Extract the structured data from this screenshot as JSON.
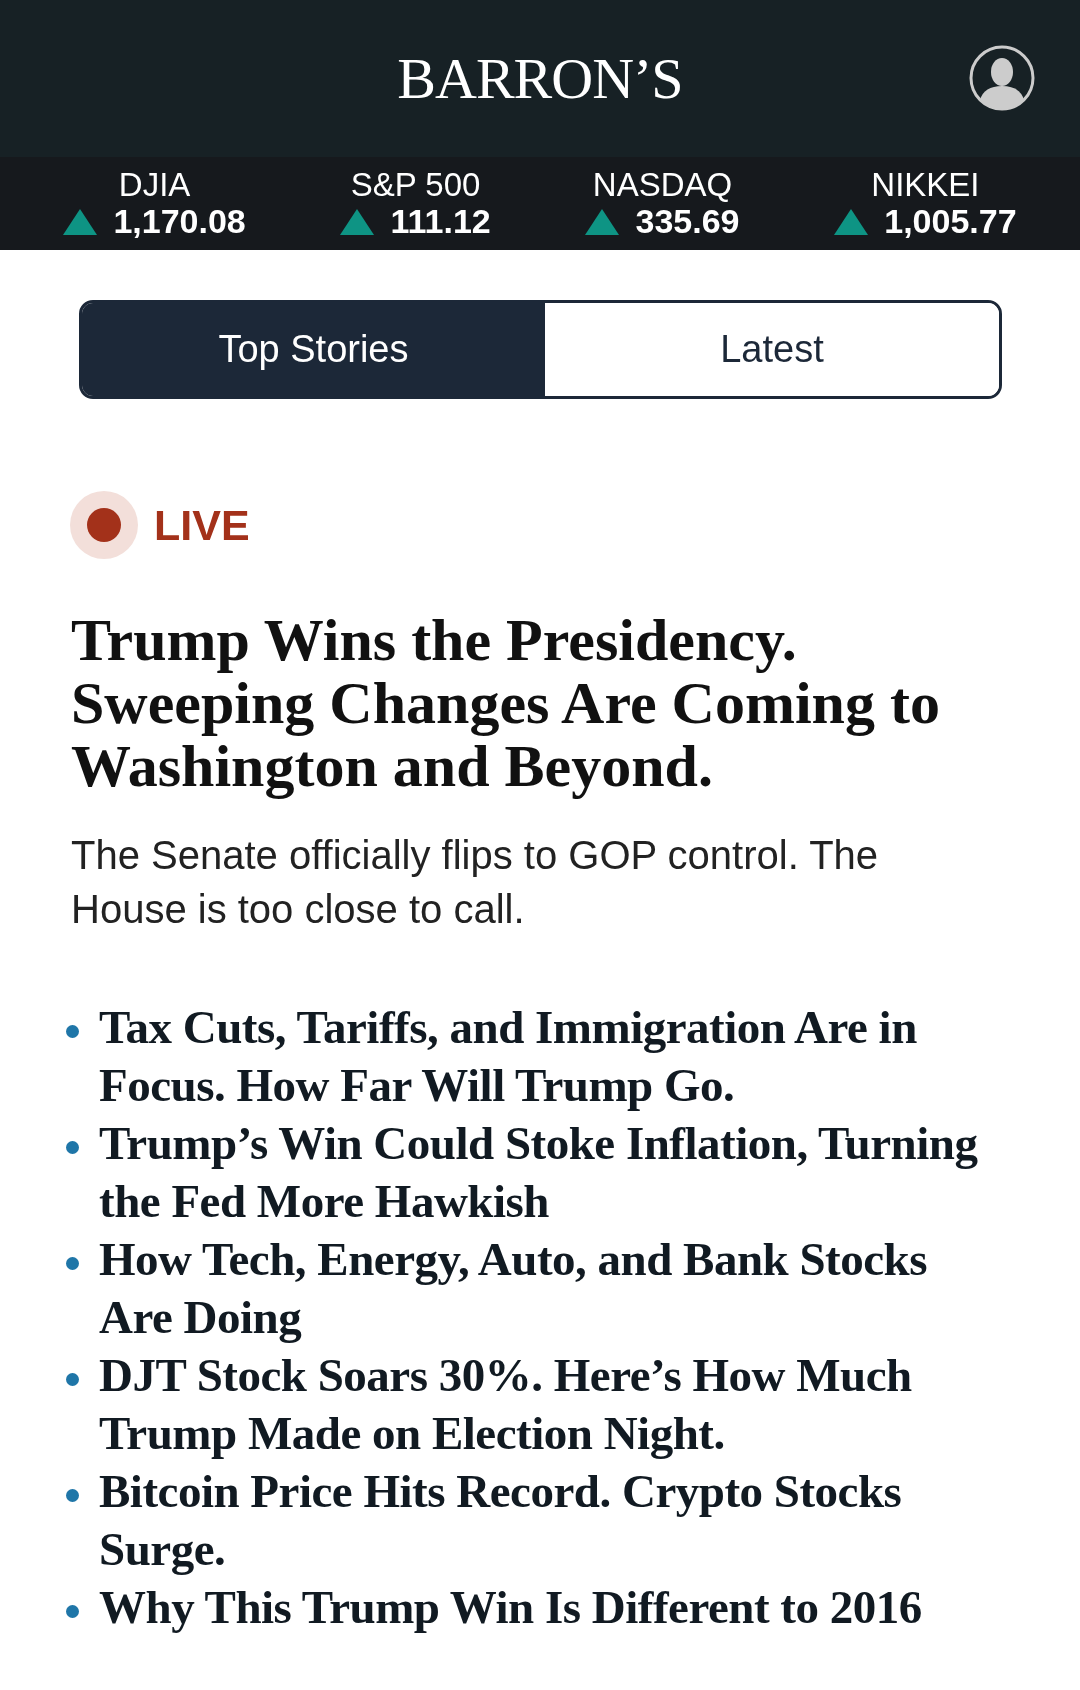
{
  "header": {
    "logo": "BARRON’S"
  },
  "ticker": [
    {
      "name": "DJIA",
      "value": "1,170.08",
      "kind": "up"
    },
    {
      "name": "S&P 500",
      "value": "111.12",
      "kind": "up"
    },
    {
      "name": "NASDAQ",
      "value": "335.69",
      "kind": "up"
    },
    {
      "name": "NIKKEI",
      "value": "1,005.77",
      "kind": "up"
    }
  ],
  "tabs": [
    {
      "label": "Top Stories",
      "selected": true
    },
    {
      "label": "Latest",
      "selected": false
    }
  ],
  "live_label": "LIVE",
  "headline": "Trump Wins the Presidency. Sweeping Changes Are Coming to Washington and Beyond.",
  "summary": "The Senate officially flips to GOP control. The House is too close to call.",
  "related": [
    "Tax Cuts, Tariffs, and Immigration Are in Focus. How Far Will Trump Go.",
    "Trump’s Win Could Stoke Inflation, Turning the Fed More Hawkish",
    "How Tech, Energy, Auto, and Bank Stocks Are Doing",
    "DJT Stock Soars 30%. Here’s How Much Trump Made on Election Night.",
    "Bitcoin Price Hits Record. Crypto Stocks Surge.",
    "Why This Trump Win Is Different to 2016"
  ]
}
